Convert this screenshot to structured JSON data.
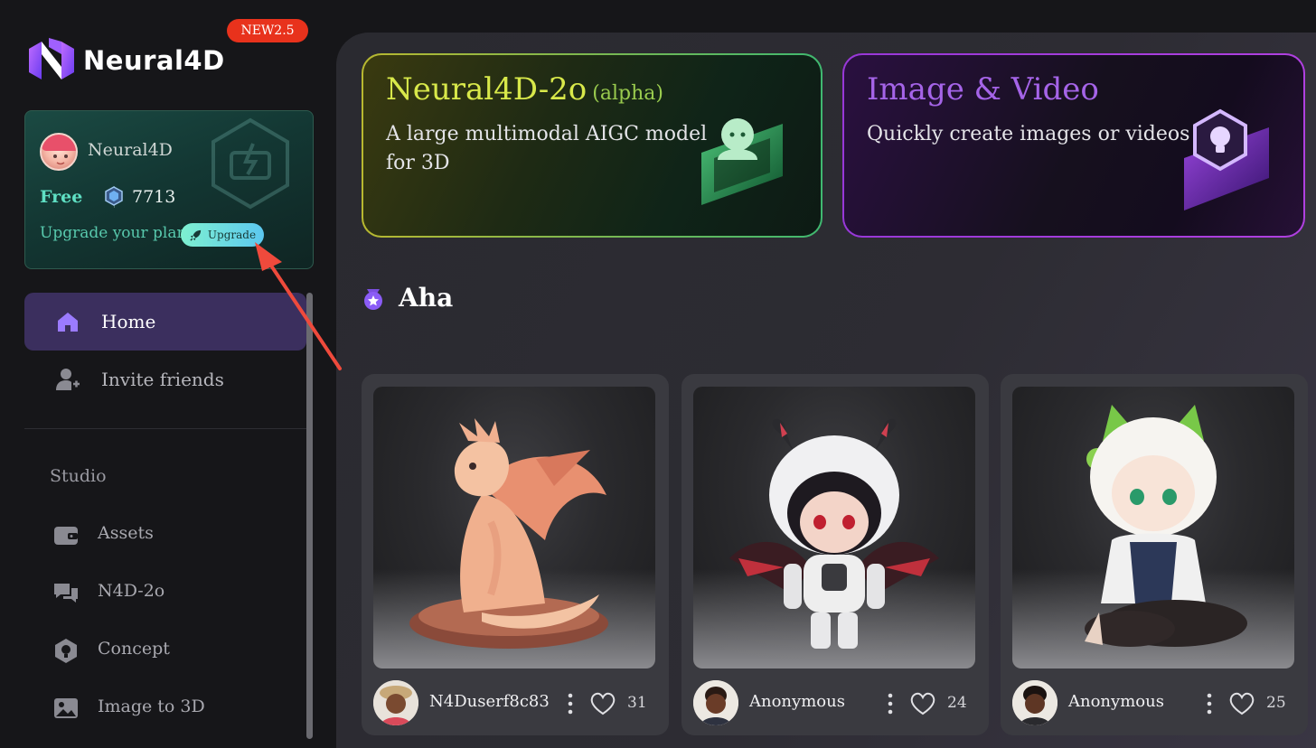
{
  "brand": {
    "name": "Neural4D",
    "badge": "NEW2.5"
  },
  "plan_card": {
    "username": "Neural4D",
    "tier": "Free",
    "credits": "7713",
    "upgrade_prompt": "Upgrade your plan",
    "upgrade_button": "Upgrade"
  },
  "nav": {
    "items": [
      {
        "label": "Home",
        "icon": "home-icon",
        "active": true
      },
      {
        "label": "Invite friends",
        "icon": "add-user-icon",
        "active": false
      }
    ],
    "section_label": "Studio",
    "studio_items": [
      {
        "label": "Assets",
        "icon": "wallet-icon"
      },
      {
        "label": "N4D-2o",
        "icon": "chat-icon"
      },
      {
        "label": "Concept",
        "icon": "concept-icon"
      },
      {
        "label": "Image to 3D",
        "icon": "image-icon"
      }
    ]
  },
  "banners": [
    {
      "title": "Neural4D-2o",
      "suffix": "(alpha)",
      "description": "A large multimodal AIGC model for 3D",
      "accent": "#d8e84a"
    },
    {
      "title": "Image & Video",
      "description": "Quickly create images or videos",
      "accent": "#a564e8"
    }
  ],
  "aha": {
    "title": "Aha"
  },
  "cards": [
    {
      "author": "N4Duserf8c83",
      "likes": "31",
      "subject": "dragon figurine"
    },
    {
      "author": "Anonymous",
      "likes": "24",
      "subject": "horned chibi robot"
    },
    {
      "author": "Anonymous",
      "likes": "25",
      "subject": "cat-eared chibi girl"
    }
  ],
  "colors": {
    "accent_purple": "#3b2f5e",
    "plan_green": "#5fe0c4",
    "badge_red": "#e8321c"
  }
}
